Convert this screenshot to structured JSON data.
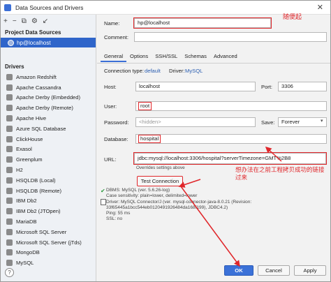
{
  "window": {
    "title": "Data Sources and Drivers",
    "close_icon": "close-icon"
  },
  "left": {
    "toolbar": [
      "+",
      "−",
      "⧉",
      "⚙",
      "↙"
    ],
    "project_label": "Project Data Sources",
    "project_item": "hp@localhost",
    "drivers_label": "Drivers",
    "drivers": [
      "Amazon Redshift",
      "Apache Cassandra",
      "Apache Derby (Embedded)",
      "Apache Derby (Remote)",
      "Apache Hive",
      "Azure SQL Database",
      "ClickHouse",
      "Exasol",
      "Greenplum",
      "H2",
      "HSQLDB (Local)",
      "HSQLDB (Remote)",
      "IBM Db2",
      "IBM Db2 (JTOpen)",
      "MariaDB",
      "Microsoft SQL Server",
      "Microsoft SQL Server (jTds)",
      "MongoDB",
      "MySQL"
    ],
    "help": "?"
  },
  "form": {
    "name_label": "Name:",
    "name_value": "hp@localhost",
    "name_annotation": "随便起",
    "comment_label": "Comment:",
    "tabs": [
      "General",
      "Options",
      "SSH/SSL",
      "Schemas",
      "Advanced"
    ],
    "conn_type_label": "Connection type:",
    "conn_type_value": "default",
    "driver_label": "Driver:",
    "driver_value": "MySQL",
    "host_label": "Host:",
    "host_value": "localhost",
    "port_label": "Port:",
    "port_value": "3306",
    "user_label": "User:",
    "user_value": "root",
    "password_label": "Password:",
    "password_value": "<hidden>",
    "save_label": "Save:",
    "save_value": "Forever",
    "database_label": "Database:",
    "database_value": "hospital",
    "url_label": "URL:",
    "url_value": "jdbc:mysql://localhost:3306/hospital?serverTimezone=GMT%2B8",
    "url_note": "Overrides settings above",
    "url_annotation": "想办法在之前工程拷贝成功的链接过来",
    "test_button": "Test Connection",
    "status_lines": "DBMS: MySQL (ver. 5.6.26-log)\nCase sensitivity: plain=lower, delimited=lower\nDriver: MySQL Connector/J (ver. mysql-connector-java-8.0.21 (Revision:\n33f65445a1bcc544eb0120491926484da168f199), JDBC4.2)\nPing: 55 ms\nSSL: no"
  },
  "buttons": {
    "ok": "OK",
    "cancel": "Cancel",
    "apply": "Apply"
  },
  "colors": {
    "accent": "#2f65ca",
    "annotation": "#e0262a"
  }
}
